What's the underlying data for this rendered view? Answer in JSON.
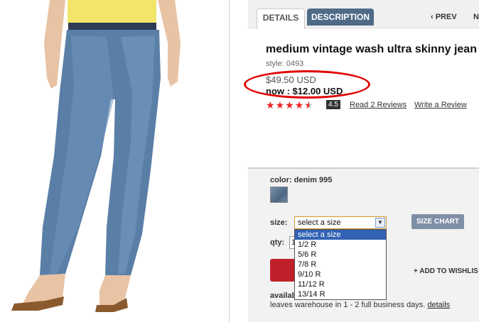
{
  "tabs": {
    "details": "DETAILS",
    "description": "DESCRIPTION"
  },
  "nav": {
    "prev": "‹ PREV",
    "next": "NE"
  },
  "product": {
    "title": "medium vintage wash ultra skinny jean",
    "style": "style: 0493",
    "price_old": "$49.50 USD",
    "price_now": "now : $12.00 USD",
    "rating": "4.5",
    "rating_value": 4.5,
    "read_reviews": "Read 2 Reviews",
    "write_review": "Write a Review"
  },
  "options": {
    "color_label": "color: denim 995",
    "size_label": "size:",
    "size_selected": "select a size",
    "size_chart": "SIZE CHART",
    "size_options": [
      "select a size",
      "1/2 R",
      "5/6 R",
      "7/8 R",
      "9/10 R",
      "11/12 R",
      "13/14 R"
    ],
    "qty_label": "qty:",
    "qty_value": "1",
    "wishlist": "+ ADD TO WISHLIS",
    "availability_label": "availab",
    "ship_text": "leaves warehouse in 1 - 2 full business days.",
    "details_link": "details"
  },
  "colors": {
    "tab_active": "#4f6b88",
    "star": "#e22222",
    "highlight_ring": "#e00000",
    "select_highlight": "#3162b4"
  }
}
